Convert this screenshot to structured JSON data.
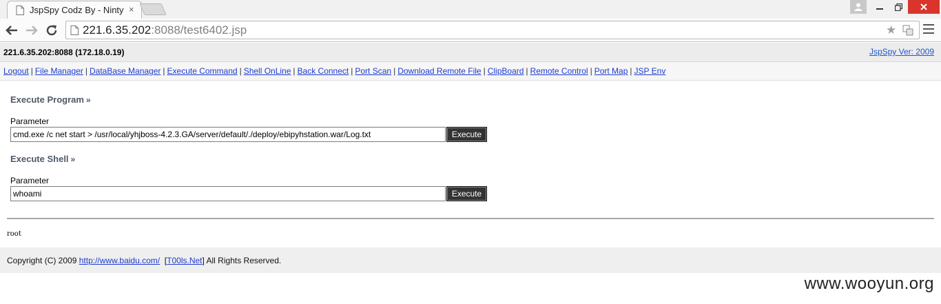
{
  "browser": {
    "tab_title": "JspSpy Codz By - Ninty",
    "tab_close": "×",
    "url_host": "221.6.35.202",
    "url_rest": ":8088/test6402.jsp"
  },
  "header": {
    "server_info": "221.6.35.202:8088 (172.18.0.19)",
    "version_link": "JspSpy Ver: 2009"
  },
  "menu": {
    "items": [
      {
        "label": "Logout"
      },
      {
        "label": "File Manager"
      },
      {
        "label": "DataBase Manager"
      },
      {
        "label": "Execute Command"
      },
      {
        "label": "Shell OnLine"
      },
      {
        "label": "Back Connect"
      },
      {
        "label": "Port Scan"
      },
      {
        "label": "Download Remote File"
      },
      {
        "label": "ClipBoard"
      },
      {
        "label": "Remote Control"
      },
      {
        "label": "Port Map"
      },
      {
        "label": "JSP Env"
      }
    ],
    "separator": "|"
  },
  "execute_program": {
    "title": "Execute Program",
    "raquo": "»",
    "param_label": "Parameter",
    "value": "cmd.exe /c net start > /usr/local/yhjboss-4.2.3.GA/server/default/./deploy/ebipyhstation.war/Log.txt",
    "button_label": "Execute"
  },
  "execute_shell": {
    "title": "Execute Shell",
    "raquo": "»",
    "param_label": "Parameter",
    "value": "whoami",
    "button_label": "Execute"
  },
  "output": {
    "text": "root"
  },
  "footer": {
    "copyright": "Copyright (C) 2009",
    "link1": "http://www.baidu.com/",
    "bracket_open": "[",
    "link2": "T00ls.Net",
    "bracket_close": "]",
    "rights": "All Rights Reserved."
  },
  "watermark": {
    "text": "www.wooyun.org"
  }
}
